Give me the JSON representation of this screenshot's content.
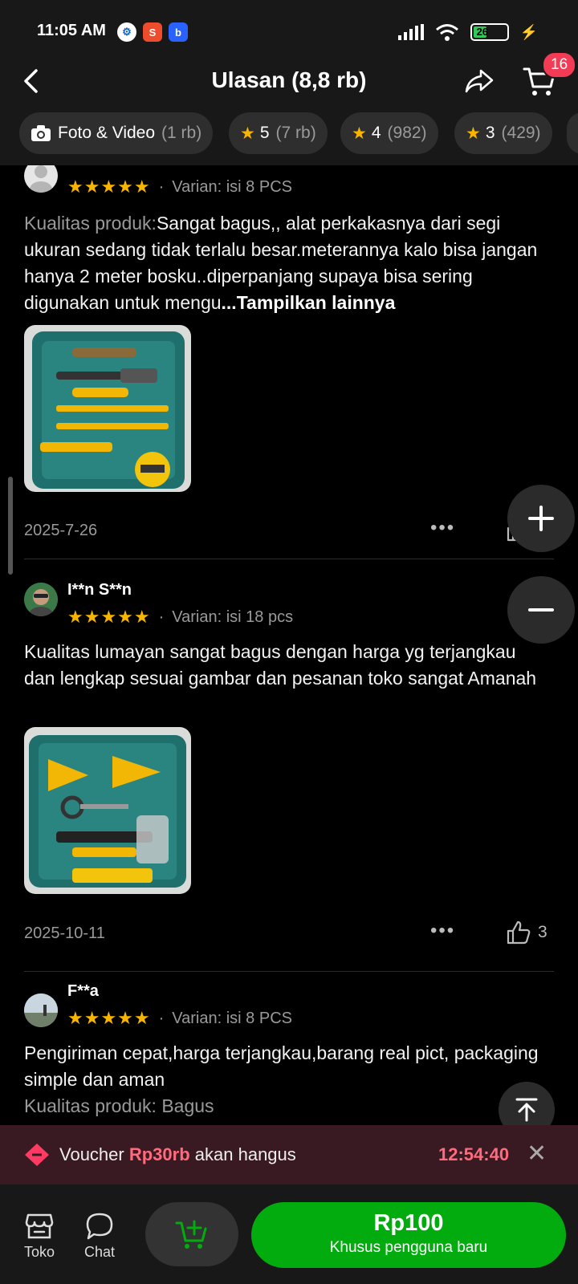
{
  "status_bar": {
    "time": "11:05 AM",
    "battery": "26"
  },
  "header": {
    "title": "Ulasan (8,8 rb)",
    "cart_count": "16"
  },
  "filters": [
    {
      "label": "Foto & Video",
      "count": "(1 rb)",
      "icon": "camera-icon"
    },
    {
      "label": "5",
      "count": "(7 rb)",
      "icon": "star-icon"
    },
    {
      "label": "4",
      "count": "(982)",
      "icon": "star-icon"
    },
    {
      "label": "3",
      "count": "(429)",
      "icon": "star-icon"
    }
  ],
  "reviews": [
    {
      "name": "",
      "stars": "★★★★★",
      "rating": 5,
      "variant": "Varian: isi 8 PCS",
      "text_label": "Kualitas produk:",
      "text": "Sangat bagus,, alat perkakasnya dari segi ukuran sedang tidak terlalu besar.meterannya kalo bisa jangan hanya 2 meter bosku..diperpanjang supaya bisa sering digunakan untuk mengu",
      "more": "...Tampilkan lainnya",
      "date": "2025-7-26",
      "likes": ""
    },
    {
      "name": "I**n S**n",
      "stars": "★★★★★",
      "rating": 5,
      "variant": "Varian: isi 18 pcs",
      "text": "Kualitas lumayan sangat bagus dengan harga yg terjangkau dan lengkap sesuai gambar dan pesanan toko sangat Amanah",
      "date": "2025-10-11",
      "likes": "3"
    },
    {
      "name": "F**a",
      "stars": "★★★★★",
      "rating": 5,
      "variant": "Varian: isi 8 PCS",
      "text": "Pengiriman cepat,harga terjangkau,barang real pict, packaging simple dan aman",
      "text2": "Kualitas produk: Bagus"
    }
  ],
  "voucher": {
    "prefix": "Voucher",
    "amount": "Rp30rb",
    "suffix": "akan hangus",
    "timer": "12:54:40"
  },
  "bottom": {
    "shop_label": "Toko",
    "chat_label": "Chat",
    "price": "Rp100",
    "price_sub": "Khusus pengguna baru"
  },
  "colors": {
    "accent_green": "#03ac0e",
    "star": "#f7b500",
    "badge_red": "#f23c55",
    "voucher_red": "#ff6b7c"
  }
}
